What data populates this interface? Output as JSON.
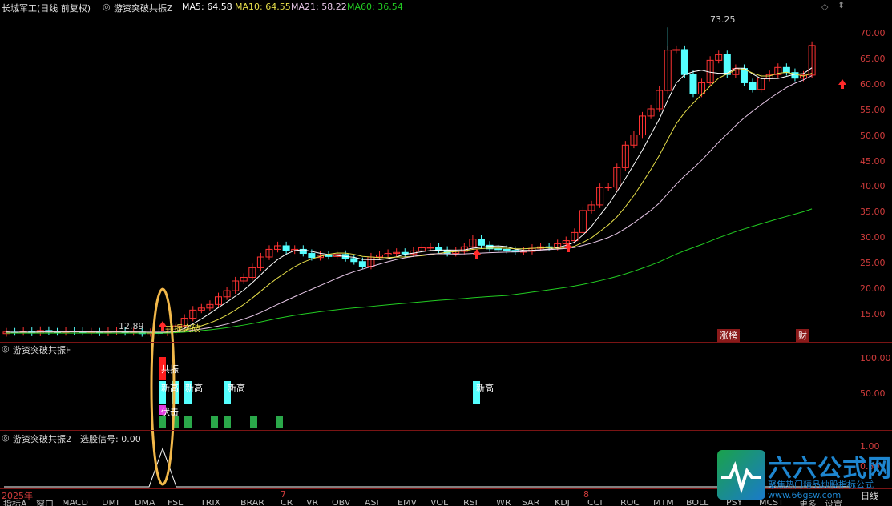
{
  "header": {
    "stock": "长城军工(日线 前复权)",
    "indicator": "游资突破共振Z",
    "ma5": "MA5: 64.58",
    "ma10": "MA10: 64.55",
    "ma21": "MA21: 58.22",
    "ma60": "MA60: 36.54"
  },
  "price_axis": [
    "70.00",
    "65.00",
    "60.00",
    "55.00",
    "50.00",
    "45.00",
    "40.00",
    "35.00",
    "30.00",
    "25.00",
    "20.00",
    "15.00"
  ],
  "annotations": {
    "high": "73.25",
    "low": "12.89",
    "breakout": "共振突破",
    "limit_up": "涨榜",
    "finance": "财"
  },
  "panel2": {
    "title": "游资突破共振F",
    "axis": [
      "100.00",
      "50.00"
    ],
    "resonance": "共振",
    "new_high": "新高",
    "ambush": "伏击"
  },
  "panel3": {
    "title": "游资突破共振2",
    "signal": "选股信号: 0.00",
    "axis": [
      "1.00",
      "0.50"
    ]
  },
  "date_axis": [
    "2025年",
    "7",
    "8"
  ],
  "period": "日线",
  "watermark": {
    "brand": "六六公式网",
    "slogan": "聚焦热门精品炒股指标公式",
    "url": "www.66gsw.com"
  },
  "bottom_tabs": [
    "指标A",
    "窗口",
    "MACD",
    "DMI",
    "DMA",
    "FSL",
    "TRIX",
    "BRAR",
    "CR",
    "VR",
    "OBV",
    "ASI",
    "EMV",
    "VOL",
    "RSI",
    "WR",
    "SAR",
    "KDJ",
    "CCI",
    "ROC",
    "MTM",
    "BOLL",
    "PSY",
    "MCST",
    "更多",
    "设置"
  ],
  "chart_data": {
    "type": "candlestick",
    "title": "长城军工(日线 前复权)",
    "ylim": [
      12,
      73.5
    ],
    "x": [
      "2025年",
      "7",
      "8"
    ],
    "moving_averages": [
      {
        "name": "MA5",
        "color": "#ffffff",
        "last": 64.58
      },
      {
        "name": "MA10",
        "color": "#e8e04a",
        "last": 64.55
      },
      {
        "name": "MA21",
        "color": "#e8c8e8",
        "last": 58.22
      },
      {
        "name": "MA60",
        "color": "#22cc22",
        "last": 36.54
      }
    ],
    "markers": {
      "high": 73.25,
      "low": 12.89
    }
  },
  "colors": {
    "up": "#ff3232",
    "down": "#54ffff",
    "ma60": "#22cc22",
    "axis": "#d23c3c"
  }
}
